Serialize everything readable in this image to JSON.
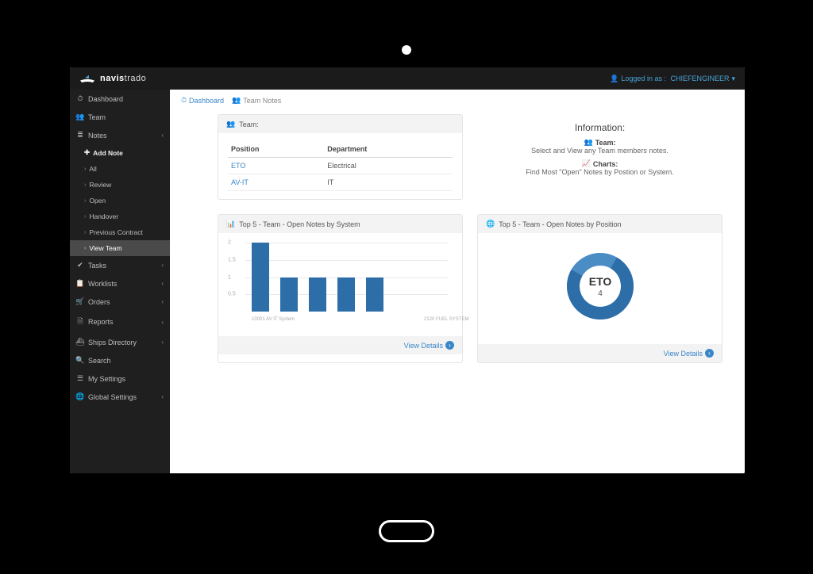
{
  "brand": {
    "strong": "navis",
    "light": "trado"
  },
  "login": {
    "prefix": "Logged in as : ",
    "user": "CHIEFENGINEER"
  },
  "crumbs": {
    "dashboard": "Dashboard",
    "current": "Team Notes"
  },
  "sidebar": {
    "dashboard": "Dashboard",
    "team": "Team",
    "notes": "Notes",
    "notes_children": {
      "add": "Add Note",
      "all": "All",
      "review": "Review",
      "open": "Open",
      "handover": "Handover",
      "previous": "Previous Contract",
      "view_team": "View Team"
    },
    "tasks": "Tasks",
    "worklists": "Worklists",
    "orders": "Orders",
    "reports": "Reports",
    "ships_directory": "Ships Directory",
    "search": "Search",
    "my_settings": "My Settings",
    "global_settings": "Global Settings"
  },
  "team_panel": {
    "title": "Team:",
    "col_position": "Position",
    "col_department": "Department",
    "rows": [
      {
        "pos": "ETO",
        "dept": "Electrical"
      },
      {
        "pos": "AV-IT",
        "dept": "IT"
      }
    ]
  },
  "info_panel": {
    "title": "Information:",
    "team_h": "Team:",
    "team_l": "Select and View any Team members notes.",
    "charts_h": "Charts:",
    "charts_l": "Find Most \"Open\" Notes by Postion or System."
  },
  "bar_panel": {
    "title": "Top 5 - Team - Open Notes by System",
    "view": "View Details"
  },
  "donut_panel": {
    "title": "Top 5 - Team - Open Notes by Position",
    "view": "View Details"
  },
  "chart_data": [
    {
      "type": "bar",
      "name": "open_notes_by_system",
      "title": "Top 5 - Team - Open Notes by System",
      "ylabel": "",
      "xlabel": "",
      "ylim": [
        0,
        2
      ],
      "yticks": [
        0.5,
        1,
        1.5,
        2
      ],
      "categories": [
        "10001 AV IT System",
        "",
        "",
        "",
        "2120 FUEL SYSTEM"
      ],
      "values": [
        2,
        1,
        1,
        1,
        1
      ],
      "bar_color": "#2d6ea8"
    },
    {
      "type": "pie",
      "name": "open_notes_by_position",
      "title": "Top 5 - Team - Open Notes by Position",
      "series": [
        {
          "name": "ETO",
          "value": 4
        }
      ],
      "center_label": "ETO",
      "center_value": "4",
      "colors": [
        "#2d6ea8",
        "#4a8cc4"
      ]
    }
  ]
}
